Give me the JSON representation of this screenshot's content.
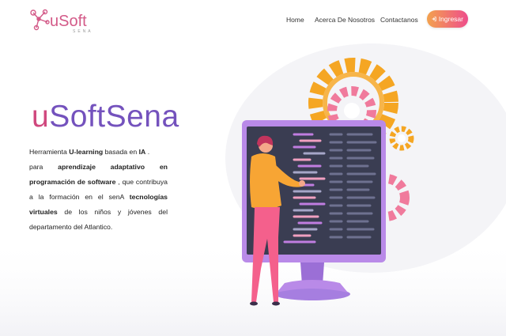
{
  "header": {
    "logo_text": "uSoft",
    "logo_sub": "SENA",
    "nav": {
      "home": "Home",
      "about": "Acerca De Nosotros",
      "contact": "Contactanos"
    },
    "login_label": "Ingresar"
  },
  "hero": {
    "title_u": "u",
    "title_rest": "SoftSena",
    "desc": {
      "p1": "Herramienta ",
      "b1": "U-learning",
      "p2": " basada en ",
      "b2": "IA",
      "p3": " .",
      "p4": "para ",
      "b3": "aprendizaje adaptativo en programación de software",
      "p5": " , que contribuya a la formación en el senA ",
      "b4": "tecnologías virtuales",
      "p6": " de los niños y jóvenes del departamento del Atlantico."
    }
  },
  "colors": {
    "brand_pink": "#d0487e",
    "brand_purple": "#7452bd",
    "button_start": "#f3a24e",
    "button_end": "#ee4d8b"
  },
  "icons": {
    "logo": "network-nodes-icon",
    "login": "sign-in-icon"
  }
}
